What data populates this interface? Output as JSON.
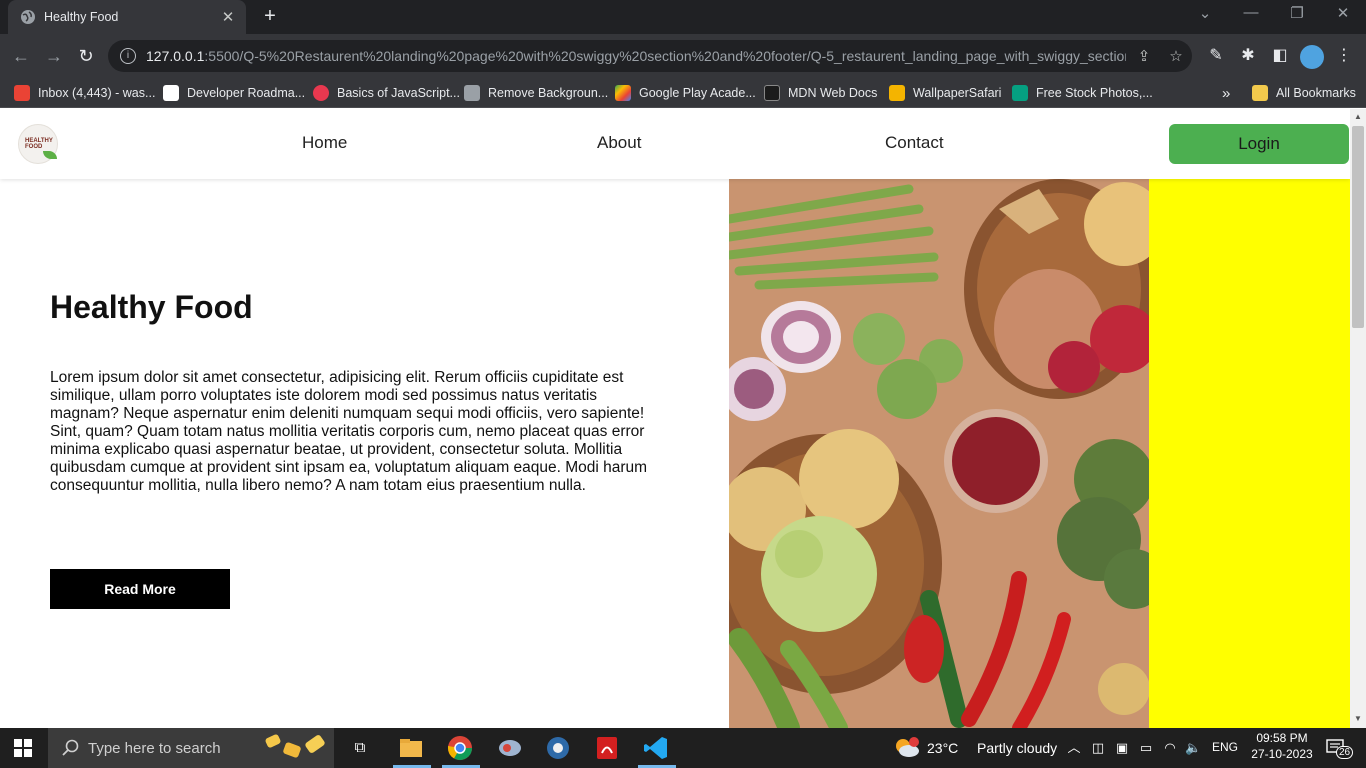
{
  "browser": {
    "tab_title": "Healthy Food",
    "tab_close": "✕",
    "new_tab": "+",
    "url_host": "127.0.0.1",
    "url_rest": ":5500/Q-5%20Restaurent%20landing%20page%20with%20swiggy%20section%20and%20footer/Q-5_restaurent_landing_page_with_swiggy_section_...",
    "bookmarks": [
      {
        "label": "Inbox (4,443) - was...",
        "color": "#ea4335"
      },
      {
        "label": "Developer Roadma...",
        "color": "#ffffff"
      },
      {
        "label": "Basics of JavaScript...",
        "color": "#e8384f"
      },
      {
        "label": "Remove Backgroun...",
        "color": "#9aa0a6"
      },
      {
        "label": "Google Play Acade...",
        "color": "#34a853"
      },
      {
        "label": "MDN Web Docs",
        "color": "#1b1b1b"
      },
      {
        "label": "WallpaperSafari",
        "color": "#f4b400"
      },
      {
        "label": "Free Stock Photos,...",
        "color": "#05a081"
      }
    ],
    "bookmarks_overflow": "»",
    "all_bookmarks": "All Bookmarks"
  },
  "site": {
    "nav": {
      "logo_text": "HEALTHY FOOD",
      "links": [
        "Home",
        "About",
        "Contact"
      ],
      "login_label": "Login",
      "login_color": "#4caf50"
    },
    "hero": {
      "title": "Healthy Food",
      "text": "Lorem ipsum dolor sit amet consectetur, adipisicing elit. Rerum officiis cupiditate est similique, ullam porro voluptates iste dolorem modi sed possimus natus veritatis magnam? Neque aspernatur enim deleniti numquam sequi modi officiis, vero sapiente! Sint, quam? Quam totam natus mollitia veritatis corporis cum, nemo placeat quas error minima explicabo quasi aspernatur beatae, ut provident, consectetur soluta. Mollitia quibusdam cumque at provident sint ipsam ea, voluptatum aliquam eaque. Modi harum consequuntur mollitia, nulla libero nemo? A nam totam eius praesentium nulla.",
      "button_label": "Read More",
      "panel_color": "#ffff00"
    }
  },
  "taskbar": {
    "search_placeholder": "Type here to search",
    "weather_temp": "23°C",
    "weather_desc": "Partly cloudy",
    "language": "ENG",
    "time": "09:58 PM",
    "date": "27-10-2023",
    "notification_count": "26"
  }
}
